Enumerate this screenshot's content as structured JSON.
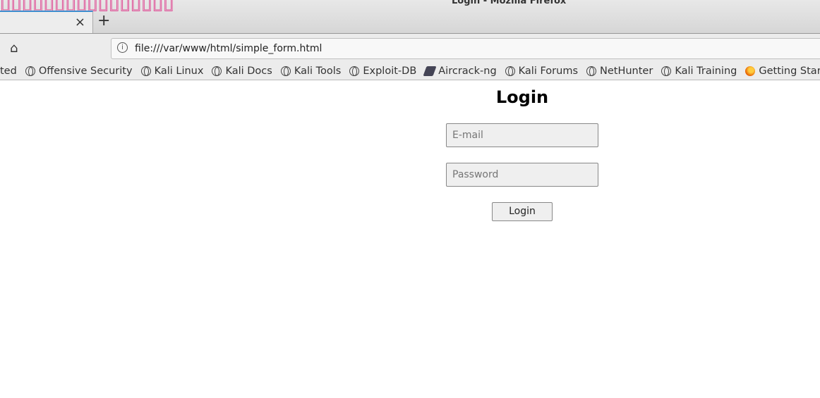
{
  "window": {
    "title": "Login - Mozilla Firefox"
  },
  "tab": {
    "close": "×",
    "new_tab": "+"
  },
  "nav": {
    "home": "⌂",
    "info": "i",
    "url": "file:///var/www/html/simple_form.html"
  },
  "bookmarks": [
    {
      "label": "ted",
      "icon": "none"
    },
    {
      "label": "Offensive Security",
      "icon": "globe"
    },
    {
      "label": "Kali Linux",
      "icon": "globe"
    },
    {
      "label": "Kali Docs",
      "icon": "globe"
    },
    {
      "label": "Kali Tools",
      "icon": "globe"
    },
    {
      "label": "Exploit-DB",
      "icon": "globe"
    },
    {
      "label": "Aircrack-ng",
      "icon": "aircrack"
    },
    {
      "label": "Kali Forums",
      "icon": "globe"
    },
    {
      "label": "NetHunter",
      "icon": "globe"
    },
    {
      "label": "Kali Training",
      "icon": "globe"
    },
    {
      "label": "Getting Started",
      "icon": "firefox"
    }
  ],
  "page": {
    "heading": "Login",
    "email_placeholder": "E-mail",
    "password_placeholder": "Password",
    "login_button": "Login"
  }
}
